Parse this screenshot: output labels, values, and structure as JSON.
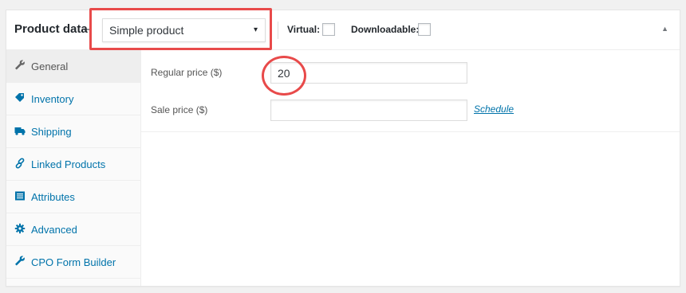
{
  "header": {
    "title": "Product data",
    "dash": "–",
    "product_type": "Simple product",
    "caret": "▾",
    "virtual_label": "Virtual:",
    "downloadable_label": "Downloadable:",
    "toggle": "▲"
  },
  "tabs": [
    {
      "label": "General",
      "icon": "wrench-icon",
      "active": true
    },
    {
      "label": "Inventory",
      "icon": "tag-icon"
    },
    {
      "label": "Shipping",
      "icon": "truck-icon"
    },
    {
      "label": "Linked Products",
      "icon": "link-icon"
    },
    {
      "label": "Attributes",
      "icon": "list-icon"
    },
    {
      "label": "Advanced",
      "icon": "gear-icon"
    },
    {
      "label": "CPO Form Builder",
      "icon": "wrench-icon"
    }
  ],
  "general": {
    "regular_price_label": "Regular price ($)",
    "regular_price_value": "20",
    "sale_price_label": "Sale price ($)",
    "sale_price_value": "",
    "schedule_link": "Schedule"
  },
  "colors": {
    "link": "#0073aa",
    "highlight": "#e84a4a",
    "active_tab_bg": "#eeeeee"
  }
}
